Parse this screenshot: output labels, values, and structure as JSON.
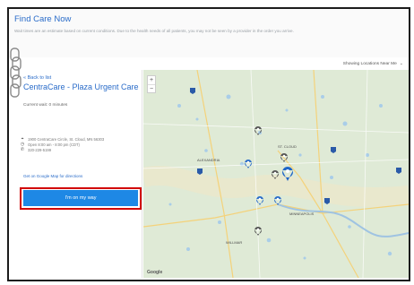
{
  "header": {
    "title": "Find Care Now",
    "notice": "Wait times are an estimate based on current conditions. Due to the health needs of all patients, you may not be seen by a provider in the order you arrive."
  },
  "filter": {
    "label": "Showing Locations Near Me",
    "chevron_icon": "chevron-down-icon"
  },
  "panel": {
    "back_link": "« Back to list",
    "facility_name": "CentraCare - Plaza Urgent Care",
    "wait_label": "Current wait: 0 minutes",
    "address": "1900 CentraCare Circle, St. Cloud, MN 56303",
    "hours": "Open 8:00 am - 8:00 pm (CDT)",
    "phone": "320-229-5199",
    "directions_link": "Get on Google Map for directions",
    "button_label": "I'm on my way"
  },
  "map": {
    "zoom_in": "+",
    "zoom_out": "−",
    "attribution": "Google",
    "places": [
      "ALEXANDRIA",
      "ST. CLOUD",
      "MINNEAPOLIS",
      "WILLMAR"
    ]
  },
  "colors": {
    "accent": "#2a6cc9",
    "button": "#1e88e5",
    "highlight": "#d10000",
    "map_land": "#dce9d1"
  }
}
